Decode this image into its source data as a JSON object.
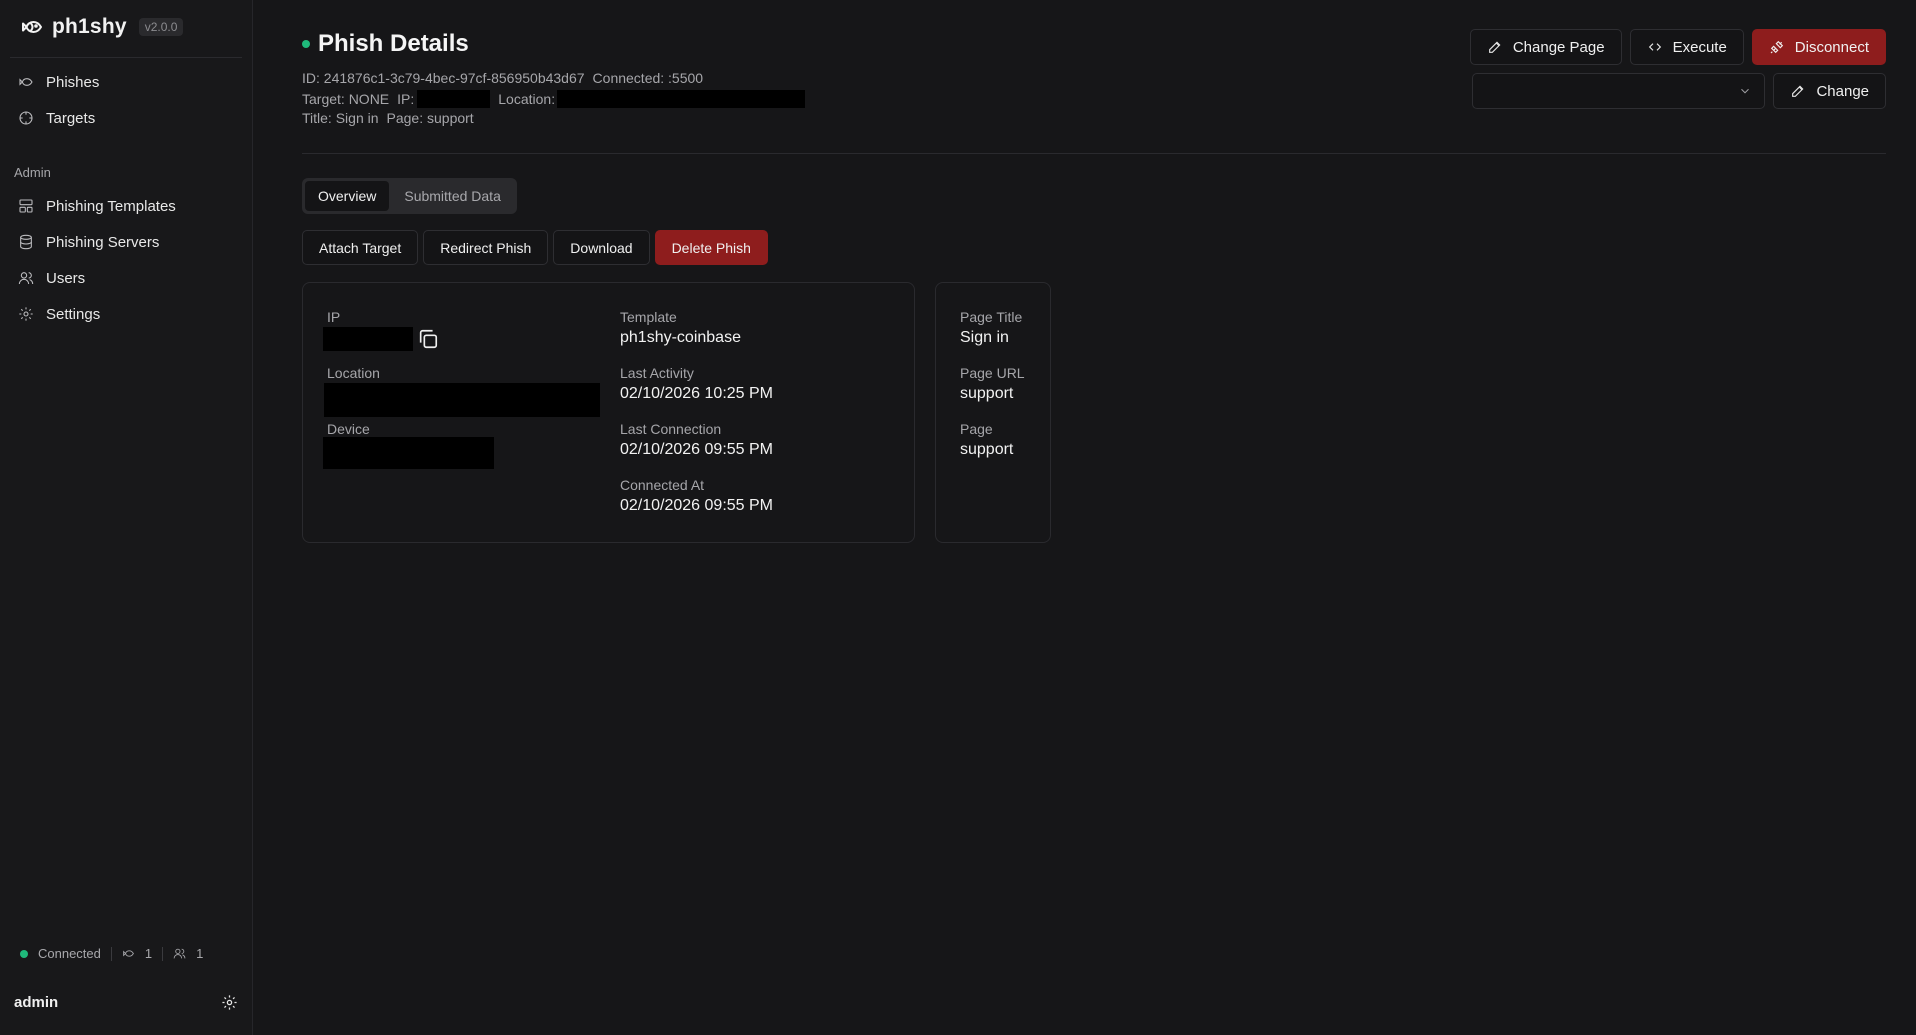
{
  "app": {
    "name": "ph1shy",
    "version": "v2.0.0"
  },
  "sidebar": {
    "items": [
      {
        "label": "Phishes",
        "icon": "fish-icon"
      },
      {
        "label": "Targets",
        "icon": "crosshair-icon"
      }
    ],
    "admin_label": "Admin",
    "admin_items": [
      {
        "label": "Phishing Templates",
        "icon": "template-icon"
      },
      {
        "label": "Phishing Servers",
        "icon": "database-icon"
      },
      {
        "label": "Users",
        "icon": "users-icon"
      },
      {
        "label": "Settings",
        "icon": "gear-icon"
      }
    ],
    "status": {
      "text": "Connected",
      "phish_count": "1",
      "user_count": "1",
      "status_color": "#1fb97b"
    },
    "username": "admin"
  },
  "header": {
    "title": "Phish Details",
    "id_line": "ID: 241876c1-3c79-4bec-97cf-856950b43d67",
    "connected_line": "Connected: :5500",
    "target_text": "Target: NONE",
    "ip_label": "IP:",
    "location_label": "Location:",
    "title_text": "Title: Sign in",
    "page_text": "Page: support"
  },
  "toolbar": {
    "change_page_label": "Change Page",
    "execute_label": "Execute",
    "disconnect_label": "Disconnect",
    "change_label": "Change",
    "page_select_value": ""
  },
  "tabs": [
    {
      "label": "Overview",
      "active": true
    },
    {
      "label": "Submitted Data",
      "active": false
    }
  ],
  "actions": {
    "attach_target": "Attach Target",
    "redirect_phish": "Redirect Phish",
    "download": "Download",
    "delete_phish": "Delete Phish"
  },
  "details": {
    "ip_label": "IP",
    "location_label": "Location",
    "device_label": "Device",
    "template_label": "Template",
    "template_value": "ph1shy-coinbase",
    "last_activity_label": "Last Activity",
    "last_activity_value": "02/10/2026 10:25 PM",
    "last_connection_label": "Last Connection",
    "last_connection_value": "02/10/2026 09:55 PM",
    "connected_at_label": "Connected At",
    "connected_at_value": "02/10/2026 09:55 PM"
  },
  "page_info": {
    "page_title_label": "Page Title",
    "page_title_value": "Sign in",
    "page_url_label": "Page URL",
    "page_url_value": "support",
    "page_label": "Page",
    "page_value": "support"
  },
  "colors": {
    "accent_red": "#8e1d1d",
    "status_green": "#1fb97b",
    "background": "#161618"
  }
}
